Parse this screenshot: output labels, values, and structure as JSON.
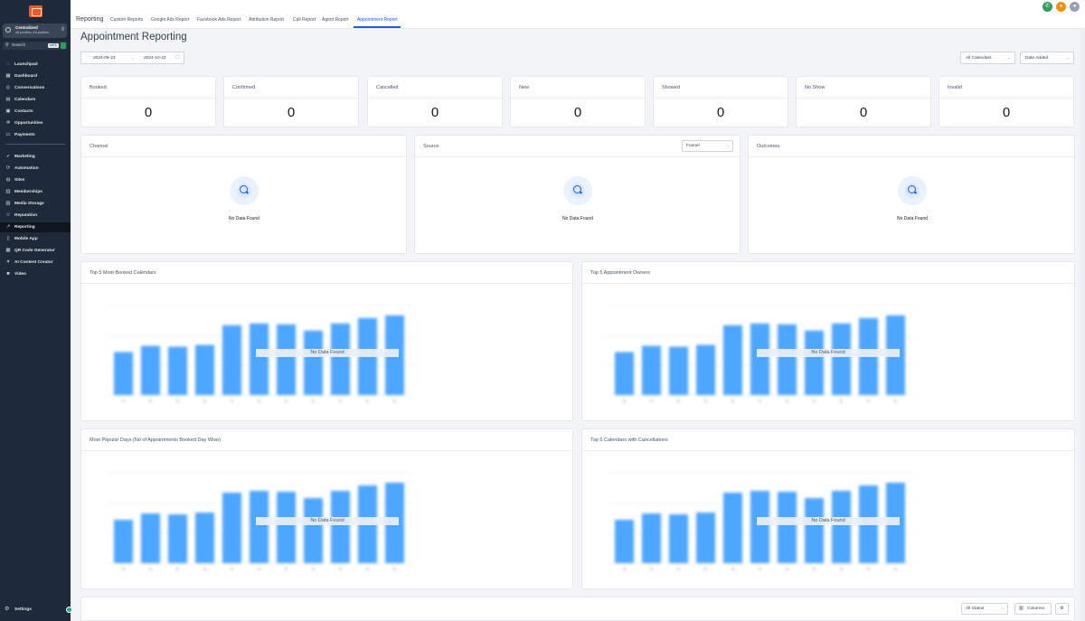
{
  "sidebar": {
    "account": {
      "name": "Centralized",
      "sub": "All profiles, All profiles"
    },
    "search": {
      "placeholder": "Search",
      "shortcut": "ctrl K"
    },
    "items": [
      {
        "label": "Launchpad",
        "icon": "rocket-icon",
        "glyph": "◌"
      },
      {
        "label": "Dashboard",
        "icon": "dashboard-icon",
        "glyph": "▦"
      },
      {
        "label": "Conversations",
        "icon": "chat-icon",
        "glyph": "◎"
      },
      {
        "label": "Calendars",
        "icon": "calendar-icon",
        "glyph": "▤"
      },
      {
        "label": "Contacts",
        "icon": "contacts-icon",
        "glyph": "▣"
      },
      {
        "label": "Opportunities",
        "icon": "opportunities-icon",
        "glyph": "✲"
      },
      {
        "label": "Payments",
        "icon": "payments-icon",
        "glyph": "▭"
      },
      {
        "label": "Marketing",
        "icon": "marketing-icon",
        "glyph": "➶"
      },
      {
        "label": "Automation",
        "icon": "automation-icon",
        "glyph": "⟳"
      },
      {
        "label": "Sites",
        "icon": "sites-icon",
        "glyph": "◍"
      },
      {
        "label": "Memberships",
        "icon": "memberships-icon",
        "glyph": "▥"
      },
      {
        "label": "Media Storage",
        "icon": "media-icon",
        "glyph": "▨"
      },
      {
        "label": "Reputation",
        "icon": "star-icon",
        "glyph": "☆"
      },
      {
        "label": "Reporting",
        "icon": "reporting-icon",
        "glyph": "↗"
      },
      {
        "label": "Mobile App",
        "icon": "mobile-icon",
        "glyph": "▯"
      },
      {
        "label": "QR Code Generator",
        "icon": "qr-icon",
        "glyph": "▩"
      },
      {
        "label": "AI Content Creator",
        "icon": "ai-icon",
        "glyph": "✦"
      },
      {
        "label": "Video",
        "icon": "video-icon",
        "glyph": "■"
      }
    ],
    "settings": "Settings"
  },
  "header": {
    "title": "Reporting",
    "tabs": [
      {
        "label": "Custom Reports"
      },
      {
        "label": "Google Ads Report"
      },
      {
        "label": "Facebook Ads Report"
      },
      {
        "label": "Attribution Report"
      },
      {
        "label": "Call Report"
      },
      {
        "label": "Agent Report"
      },
      {
        "label": "Appointment Report"
      }
    ],
    "active_tab": "Appointment Report"
  },
  "page": {
    "title": "Appointment Reporting",
    "date_from": "2024-09-23",
    "date_separator": "→",
    "date_to": "2024-10-22",
    "calendar_filter": "All Calendars",
    "date_type": "Date Added"
  },
  "stats": [
    {
      "label": "Booked",
      "value": "0"
    },
    {
      "label": "Confirmed",
      "value": "0"
    },
    {
      "label": "Cancelled",
      "value": "0"
    },
    {
      "label": "New",
      "value": "0"
    },
    {
      "label": "Showed",
      "value": "0"
    },
    {
      "label": "No Show",
      "value": "0"
    },
    {
      "label": "Invalid",
      "value": "0"
    }
  ],
  "panels": {
    "channel": {
      "title": "Channel",
      "empty": "No Data Found"
    },
    "source": {
      "title": "Source",
      "empty": "No Data Found",
      "view": "Funnel"
    },
    "outcomes": {
      "title": "Outcomes",
      "empty": "No Data Found"
    }
  },
  "charts": {
    "top_calendars": {
      "title": "Top 5 Most Booked Calendars",
      "empty": "No Data Found"
    },
    "top_owners": {
      "title": "Top 5 Appointment Owners",
      "empty": "No Data Found"
    },
    "popular_days": {
      "title": "Most Popular Days (No of Appointments Booked Day Wise)",
      "empty": "No Data Found"
    },
    "top_cancellations": {
      "title": "Top 5 Calendars with Cancellations",
      "empty": "No Data Found"
    }
  },
  "chart_data": [
    {
      "type": "bar",
      "title": "Top 5 Most Booked Calendars",
      "values": [
        48,
        55,
        54,
        56,
        78,
        80,
        79,
        72,
        80,
        86,
        89
      ],
      "ylim": [
        0,
        100
      ]
    },
    {
      "type": "bar",
      "title": "Top 5 Appointment Owners",
      "values": [
        48,
        55,
        54,
        56,
        78,
        80,
        79,
        72,
        80,
        86,
        89
      ],
      "ylim": [
        0,
        100
      ]
    },
    {
      "type": "bar",
      "title": "Most Popular Days (No of Appointments Booked Day Wise)",
      "values": [
        48,
        55,
        54,
        56,
        78,
        80,
        79,
        72,
        80,
        86,
        89
      ],
      "ylim": [
        0,
        100
      ]
    },
    {
      "type": "bar",
      "title": "Top 5 Calendars with Cancellations",
      "values": [
        48,
        55,
        54,
        56,
        78,
        80,
        79,
        72,
        80,
        86,
        89
      ],
      "ylim": [
        0,
        100
      ]
    }
  ],
  "table_controls": {
    "status": "All Status",
    "columns": "Columns"
  },
  "colors": {
    "sidebar": "#1e2939",
    "accent": "#155eef",
    "bar": "#4da6ff",
    "phone": "#2f9e5b",
    "bell": "#f79009"
  }
}
